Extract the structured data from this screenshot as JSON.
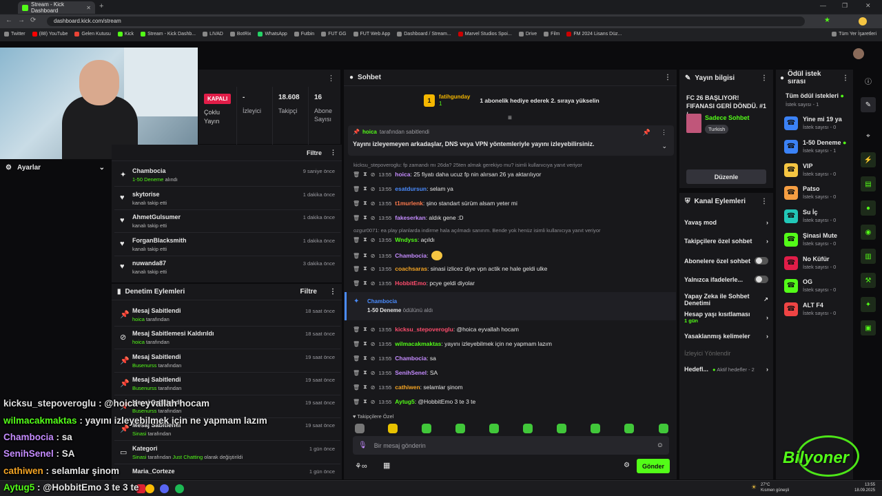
{
  "browser": {
    "tab_title": "Stream - Kick Dashboard",
    "url": "dashboard.kick.com/stream",
    "bookmarks": [
      "Twitter",
      "(88) YouTube",
      "Gelen Kutusu",
      "Kick",
      "Stream - Kick Dashb...",
      "LIVAD",
      "BotRix",
      "WhatsApp",
      "Futbin",
      "FUT GG",
      "FUT Web App",
      "Dashboard / Stream...",
      "Marvel Studios Spoi...",
      "Drive",
      "Film",
      "FM 2024 Lisans Düz..."
    ],
    "all_bookmarks": "Tüm Yer İşaretleri"
  },
  "settings": {
    "label": "Ayarlar"
  },
  "stream_stats": {
    "status": "KAPALI",
    "mode": "Çoklu Yayın",
    "viewers_value": "-",
    "viewers_label": "İzleyici",
    "followers_value": "18.608",
    "followers_label": "Takipçi",
    "subs_value": "16",
    "subs_label": "Abone Sayısı"
  },
  "activity": {
    "filter": "Filtre",
    "items": [
      {
        "name": "Chambocia",
        "sub": "1-50 Deneme",
        "sub_suffix": " alındı",
        "time": "9 saniye önce"
      },
      {
        "name": "skytorise",
        "sub": "kanalı takip etti",
        "time": "1 dakika önce"
      },
      {
        "name": "AhmetGulsumer",
        "sub": "kanalı takip etti",
        "time": "1 dakika önce"
      },
      {
        "name": "ForganBlacksmith",
        "sub": "kanalı takip etti",
        "time": "1 dakika önce"
      },
      {
        "name": "nuwanda87",
        "sub": "kanalı takip etti",
        "time": "3 dakika önce"
      }
    ]
  },
  "mod_actions": {
    "title": "Denetim Eylemleri",
    "filter": "Filtre",
    "items": [
      {
        "title": "Mesaj Sabitlendi",
        "who": "hoica",
        "suffix": " tarafından",
        "time": "18 saat önce"
      },
      {
        "title": "Mesaj Sabitlemesi Kaldırıldı",
        "who": "hoica",
        "suffix": " tarafından",
        "time": "18 saat önce"
      },
      {
        "title": "Mesaj Sabitlendi",
        "who": "Busenurss",
        "suffix": " tarafından",
        "time": "19 saat önce"
      },
      {
        "title": "Mesaj Sabitlendi",
        "who": "Busenurss",
        "suffix": " tarafından",
        "time": "19 saat önce"
      },
      {
        "title": "Mesaj Sabitlendi",
        "who": "Busenurss",
        "suffix": " tarafından",
        "time": "19 saat önce"
      },
      {
        "title": "Mesaj Sabitlendi",
        "who": "Sinasi",
        "suffix": " tarafından",
        "time": "19 saat önce"
      },
      {
        "title": "Kategori",
        "who": "Sinasi",
        "suffix": " tarafından ",
        "extra": "Just Chatting",
        "extra_suffix": " olarak değiştirildi",
        "time": "1 gün önce"
      },
      {
        "title": "Maria_Corteze",
        "who": "",
        "suffix": "",
        "time": "1 gün önce"
      }
    ]
  },
  "chat": {
    "title": "Sohbet",
    "gift_user": "fatihgunday",
    "gift_count": "1",
    "gift_text": "1 abonelik hediye ederek 2. sıraya yükselin",
    "pinned_user": "hoica",
    "pinned_by": " tarafından sabitlendi",
    "pinned_text": "Yayını izleyemeyen arkadaşlar, DNS veya VPN yöntemleriyle yayını izleyebilirsiniz.",
    "reply1": "kicksu_stepoveroglu: fp zamandı mı 26da? 25ten almak gerekiyo mu? isimli kullanıcıya yanıt veriyor",
    "reply2": "ozgur0071: ea play planlarda indirme hala açılmadı sanırım. Bende yok henüz isimli kullanıcıya yanıt veriyor",
    "messages": [
      {
        "time": "13:55",
        "user": "hoica",
        "text": ": 25 fiyatı daha ucuz fp nin alırsan 26 ya aktarılıyor"
      },
      {
        "time": "13:55",
        "user": "esatdursun",
        "text": ": selam ya"
      },
      {
        "time": "13:55",
        "user": "t1murlenk",
        "text": ": şino standart sürüm alsam yeter mi"
      },
      {
        "time": "13:55",
        "user": "fakeserkan",
        "text": ": aldık gene :D"
      },
      {
        "time": "13:55",
        "user": "Wndyss",
        "text": ": açıldı"
      },
      {
        "time": "13:55",
        "user": "Chambocia",
        "text": ":"
      },
      {
        "time": "13:55",
        "user": "coachsaras",
        "text": ": sinasi izlicez diye vpn actik ne hale geldi ulke"
      },
      {
        "time": "13:55",
        "user": "HobbitEmo",
        "text": ": pcye geldi diyolar"
      },
      {
        "time": "13:55",
        "user": "kicksu_stepoveroglu",
        "text": ": @hoica eyvallah hocam"
      },
      {
        "time": "13:55",
        "user": "wilmacakmaktas",
        "text": ": yayını izleyebilmek için ne yapmam lazım"
      },
      {
        "time": "13:55",
        "user": "Chambocia",
        "text": ": sa"
      },
      {
        "time": "13:55",
        "user": "SenihSenel",
        "text": ": SA"
      },
      {
        "time": "13:55",
        "user": "cathiwen",
        "text": ": selamlar şinom"
      },
      {
        "time": "13:55",
        "user": "Aytug5",
        "text": ": @HobbitEmo 3 te 3 te"
      }
    ],
    "redeem_user": "Chambocia",
    "redeem_reward": "1-50 Deneme",
    "redeem_suffix": " ödülünü aldı",
    "followers_only": "Takipçilere Özel",
    "input_placeholder": "Bir mesaj gönderin",
    "send": "Gönder"
  },
  "stream_info": {
    "title": "Yayın bilgisi",
    "stream_title": "FC 26 BAŞLIYOR! FIFANASI GERİ DÖNDÜ. #1 /...",
    "category": "Sadece Sohbet",
    "language": "Turkish",
    "edit": "Düzenle"
  },
  "channel_actions": {
    "title": "Kanal Eylemleri",
    "items": [
      "Yavaş mod",
      "Takipçilere özel sohbet",
      "Abonelere özel sohbet",
      "Yalnızca ifadelerle...",
      "Yapay Zeka ile Sohbet Denetimi",
      "Hesap yaşı kısıtlaması",
      "Yasaklanmış kelimeler",
      "İzleyici Yönlendir",
      "Hedefl..."
    ],
    "age_value": "1 gün",
    "goals_value": "Aktif hedefler - 2"
  },
  "rewards": {
    "title": "Ödül istek sırası",
    "all_label": "Tüm ödül istekleri",
    "all_count": "İstek sayısı - 1",
    "items": [
      {
        "name": "Yine mi 19 ya",
        "count": "İstek sayısı - 0",
        "color": "#3b82f6"
      },
      {
        "name": "1-50 Deneme",
        "count": "İstek sayısı - 1",
        "color": "#3b82f6"
      },
      {
        "name": "VIP",
        "count": "İstek sayısı - 0",
        "color": "#f5c542"
      },
      {
        "name": "Patso",
        "count": "İstek sayısı - 0",
        "color": "#f59e42"
      },
      {
        "name": "Su İç",
        "count": "İstek sayısı - 0",
        "color": "#22c7b8"
      },
      {
        "name": "Şinasi Mute",
        "count": "İstek sayısı - 0",
        "color": "#53fc18"
      },
      {
        "name": "No Küfür",
        "count": "İstek sayısı - 0",
        "color": "#e11d48"
      },
      {
        "name": "OG",
        "count": "İstek sayısı - 0",
        "color": "#53fc18"
      },
      {
        "name": "ALT F4",
        "count": "İstek sayısı - 0",
        "color": "#ef4444"
      }
    ]
  },
  "overlay": {
    "lines": [
      {
        "user": "kicksu_stepoveroglu",
        "text": " : @hoica eyvallah hocam",
        "color": "#e0e0e0"
      },
      {
        "user": "wilmacakmaktas",
        "text": " : yayını izleyebilmek için ne yapmam lazım",
        "color": "#53fc18"
      },
      {
        "user": "Chambocia",
        "text": " : sa",
        "color": "#c58cff"
      },
      {
        "user": "SenihSenel",
        "text": " : SA",
        "color": "#c58cff"
      },
      {
        "user": "cathiwen",
        "text": " : selamlar şinom",
        "color": "#f5a524"
      },
      {
        "user": "Aytug5",
        "text": " : @HobbitEmo 3 te 3 te",
        "color": "#53fc18"
      }
    ],
    "logo": "Bilyoner"
  },
  "taskbar": {
    "weather_temp": "27°C",
    "weather_text": "Kısmen güneşli",
    "time": "13:55",
    "date": "18.09.2025"
  }
}
